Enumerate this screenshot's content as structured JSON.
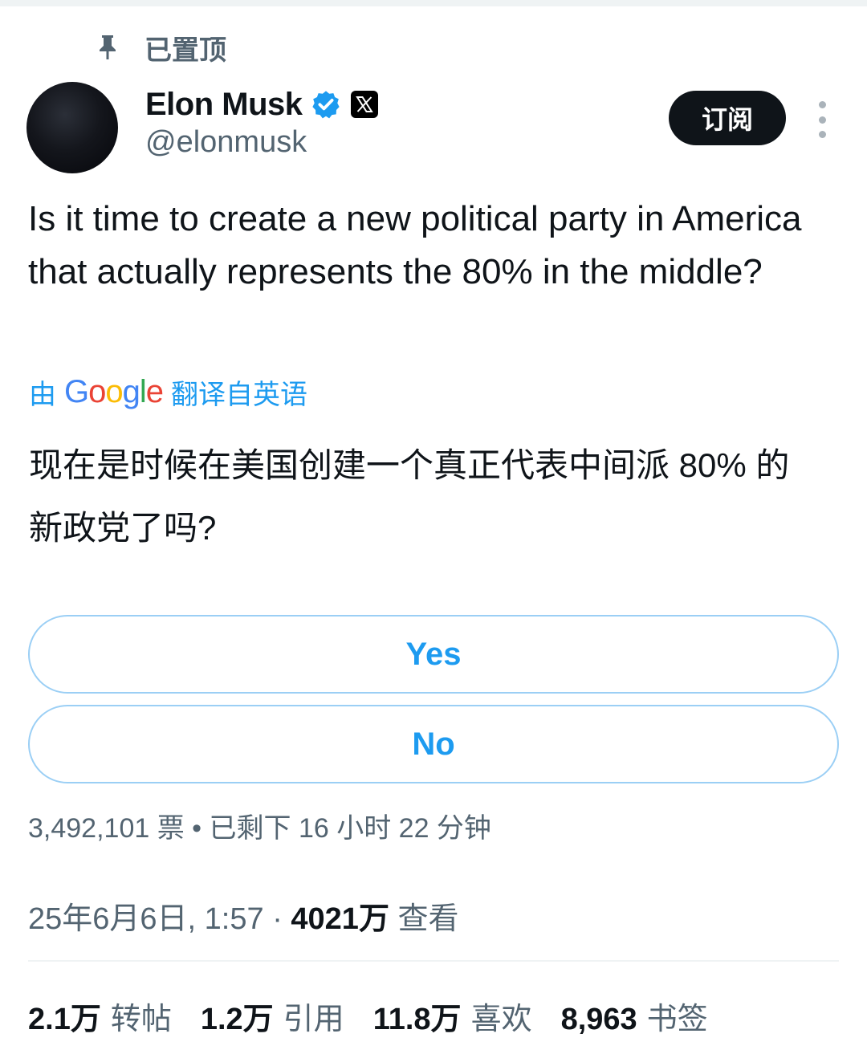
{
  "pinned": {
    "label": "已置顶"
  },
  "author": {
    "name": "Elon Musk",
    "handle": "@elonmusk"
  },
  "actions": {
    "subscribe_label": "订阅"
  },
  "tweet": {
    "text": "Is it time to create a new political party in America that actually represents the 80% in the middle?"
  },
  "translation": {
    "prefix": "由",
    "provider": "Google",
    "suffix": "翻译自英语",
    "text": "现在是时候在美国创建一个真正代表中间派 80% 的新政党了吗?"
  },
  "poll": {
    "options": [
      "Yes",
      "No"
    ],
    "votes": "3,492,101 票",
    "separator": "•",
    "time_left": "已剩下 16 小时 22 分钟"
  },
  "meta": {
    "timestamp": "25年6月6日, 1:57",
    "separator": "·",
    "views_count": "4021万",
    "views_label": "查看"
  },
  "stats": [
    {
      "count": "2.1万",
      "label": "转帖"
    },
    {
      "count": "1.2万",
      "label": "引用"
    },
    {
      "count": "11.8万",
      "label": "喜欢"
    },
    {
      "count": "8,963",
      "label": "书签"
    }
  ],
  "colors": {
    "accent": "#1d9bf0",
    "text_primary": "#0f1419",
    "text_secondary": "#536471",
    "poll_border": "#9bcff5"
  }
}
